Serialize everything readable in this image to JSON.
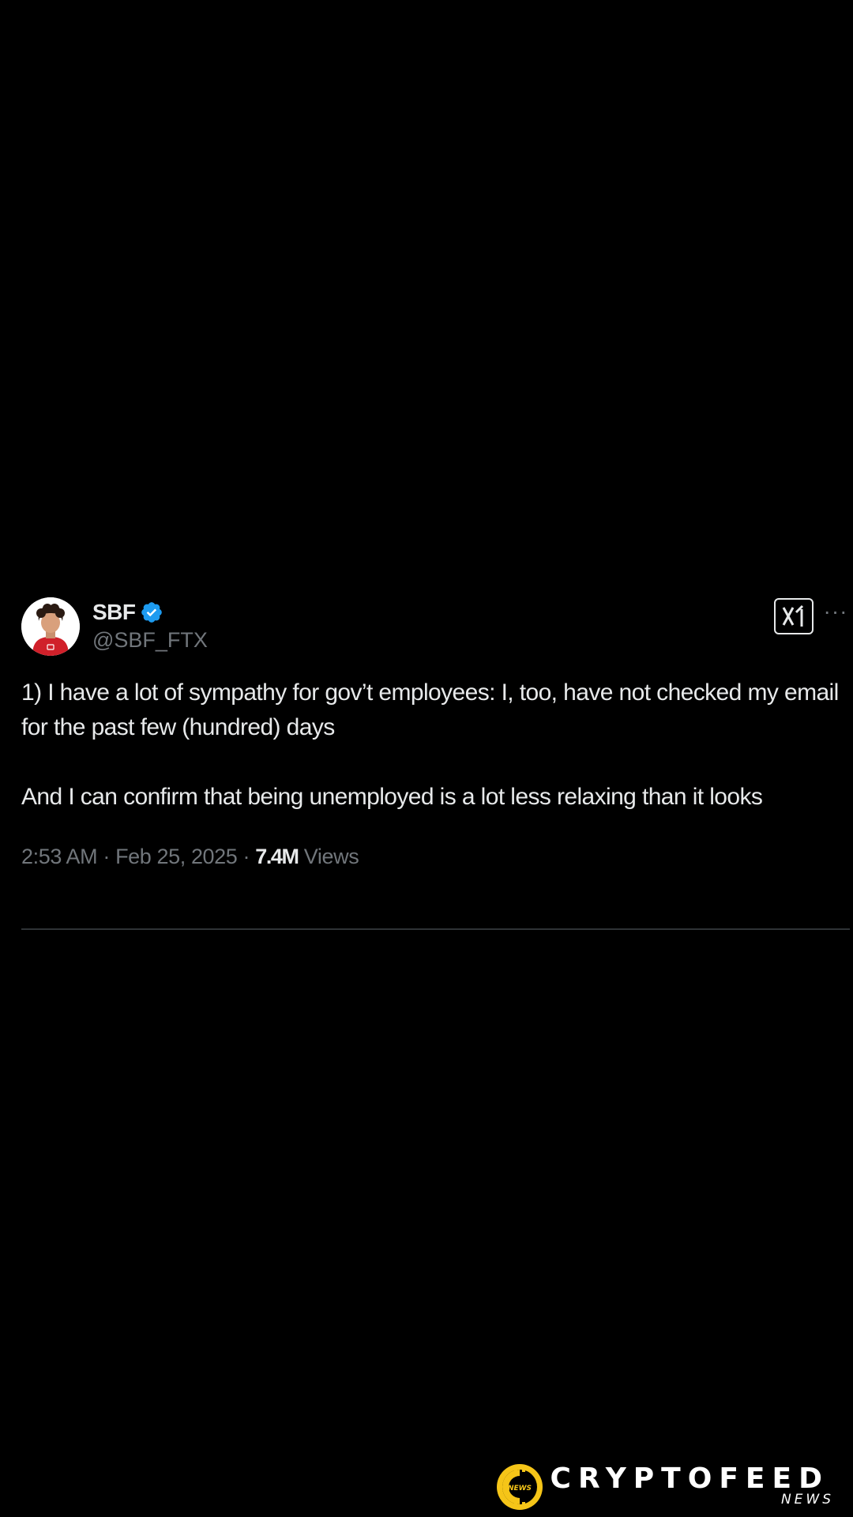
{
  "tweet": {
    "author_name": "SBF",
    "author_handle": "@SBF_FTX",
    "verified_badge": "verified-checkmark-icon",
    "paragraphs": [
      "1) I have a lot of sympathy for gov’t employees: I, too, have not checked my email for the past few (hundred) days",
      "And I can confirm that being unemployed is a lot less relaxing than it looks"
    ],
    "time": "2:53 AM",
    "separator": "·",
    "date": "Feb 25, 2025",
    "views_count": "7.4M",
    "views_label": "Views",
    "more_label": "···",
    "grok_icon": "grok-icon"
  },
  "watermark": {
    "main": "CRYPTOFEED",
    "sub": "NEWS",
    "logo_text": "NEWS"
  },
  "colors": {
    "background": "#000000",
    "text": "#e7e9ea",
    "secondary_text": "#71767b",
    "verified_blue": "#1d9bf0",
    "divider": "#2f3336",
    "watermark_yellow": "#f5c518"
  }
}
